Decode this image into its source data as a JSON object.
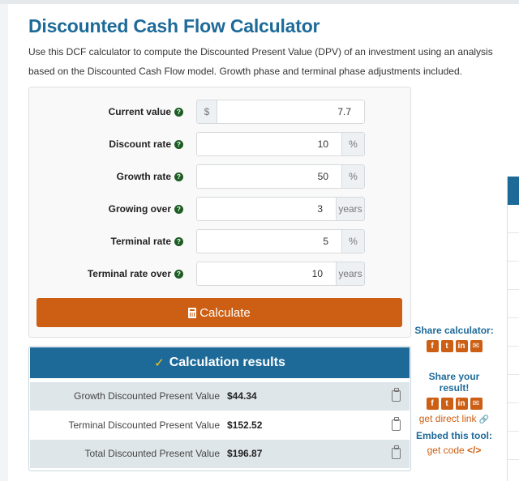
{
  "page": {
    "title": "Discounted Cash Flow Calculator",
    "intro": "Use this DCF calculator to compute the Discounted Present Value (DPV) of an investment using an analysis based on the Discounted Cash Flow model. Growth phase and terminal phase adjustments included."
  },
  "form": {
    "fields": [
      {
        "label": "Current value",
        "value": "7.7",
        "prefix": "$",
        "suffix": null,
        "help_icon": "question-circle-icon"
      },
      {
        "label": "Discount rate",
        "value": "10",
        "prefix": null,
        "suffix": "%",
        "help_icon": "question-circle-icon"
      },
      {
        "label": "Growth rate",
        "value": "50",
        "prefix": null,
        "suffix": "%",
        "help_icon": "question-circle-icon"
      },
      {
        "label": "Growing over",
        "value": "3",
        "prefix": null,
        "suffix": "years",
        "help_icon": "question-circle-icon"
      },
      {
        "label": "Terminal rate",
        "value": "5",
        "prefix": null,
        "suffix": "%",
        "help_icon": "question-circle-icon"
      },
      {
        "label": "Terminal rate over",
        "value": "10",
        "prefix": null,
        "suffix": "years",
        "help_icon": "question-circle-icon"
      }
    ],
    "help_glyph": "?",
    "calculate_label": "Calculate",
    "calculate_icon": "calculator-icon"
  },
  "results": {
    "header": "Calculation results",
    "header_icon": "checkmark-icon",
    "check_glyph": "✓",
    "rows": [
      {
        "label": "Growth Discounted Present Value",
        "value": "$44.34"
      },
      {
        "label": "Terminal Discounted Present Value",
        "value": "$152.52"
      },
      {
        "label": "Total Discounted Present Value",
        "value": "$196.87"
      }
    ]
  },
  "sidebar": {
    "share_calculator": "Share calculator:",
    "share_result": "Share your result!",
    "direct_link": "get direct link",
    "direct_link_glyph": "🔗",
    "embed_title": "Embed this tool:",
    "get_code": "get code",
    "code_glyph": "</>",
    "social": [
      {
        "name": "facebook",
        "glyph": "f"
      },
      {
        "name": "twitter",
        "glyph": "t"
      },
      {
        "name": "linkedin",
        "glyph": "in"
      },
      {
        "name": "email",
        "glyph": "✉"
      }
    ]
  },
  "colors": {
    "brand_blue": "#1d6a99",
    "accent_orange": "#cc5f14",
    "help_green": "#1d5d24"
  }
}
